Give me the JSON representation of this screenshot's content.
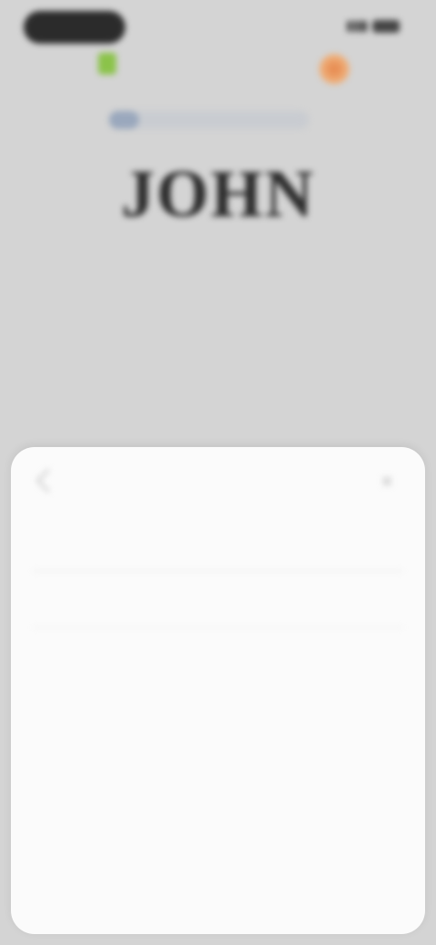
{
  "status_bar": {
    "time": ""
  },
  "reader": {
    "progress_pct": 15,
    "level": "",
    "title": "JOHN",
    "chapter": "",
    "paragraph": ""
  },
  "sheet": {
    "title": "",
    "section_label": "",
    "item_label": "",
    "close_symbol": "×"
  },
  "colors": {
    "background": "#d4d4d4",
    "sheet": "#fbfbfb",
    "book_icon": "#8bc34a",
    "streak_icon": "#e6854a"
  },
  "icons": [
    "book-icon",
    "fire-icon",
    "signal-icon",
    "battery-icon",
    "back-chevron-icon",
    "close-icon"
  ]
}
